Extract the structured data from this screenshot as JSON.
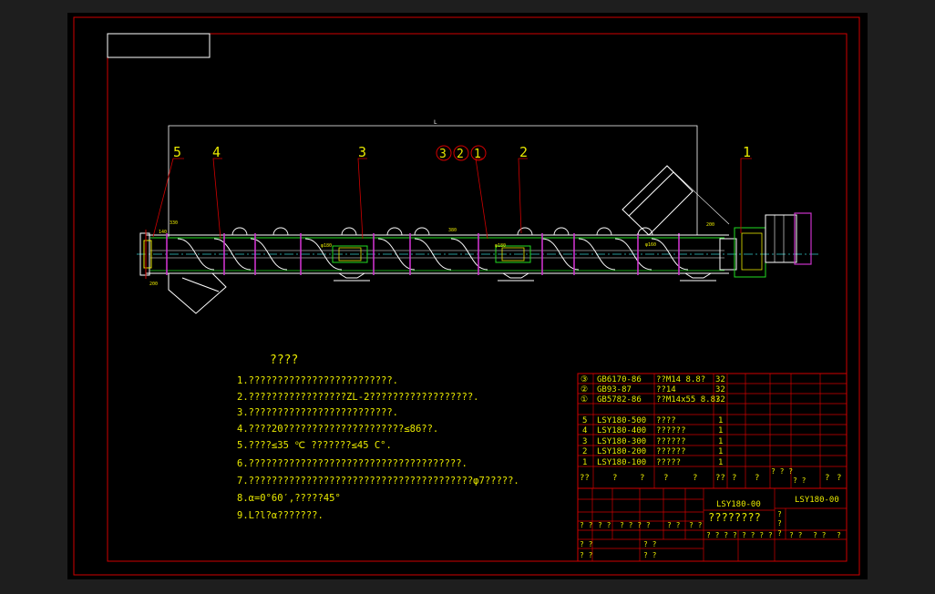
{
  "colors": {
    "background": "#1e1e1e",
    "paper": "#000000",
    "frame": "#d00000",
    "green": "#22dd22",
    "yellow": "#e8e800",
    "magenta": "#cc33cc",
    "cyan": "#33cccc",
    "white": "#ffffff",
    "blue": "#4466ff"
  },
  "drawing": {
    "dim_L": "L",
    "balloons": {
      "b5": "5",
      "b4": "4",
      "b3": "3",
      "b2": "2",
      "b1": "1",
      "c3": "3",
      "c2": "2",
      "c1": "1"
    },
    "dims": {
      "d140": "140",
      "d330": "330",
      "d200a": "200",
      "d200b": "200",
      "d380": "380",
      "d180": "φ180",
      "d1e5": "φ180",
      "d2160": "φ160"
    }
  },
  "notes": {
    "title": "????",
    "items": [
      "1.?????????????????????????.",
      "2.?????????????????ZL-2??????????????????.",
      "3.?????????????????????????.",
      "4.????20?????????????????????≤86??.",
      "5.????≤35 ℃ ???????≤45 C°.",
      "6.?????????????????????????????????????.",
      "7.???????????????????????????????????????φ7?????.",
      "8.α=0°60′,?????45°",
      "9.L?l?α???????."
    ]
  },
  "parts_list": {
    "rows": [
      {
        "no": "③",
        "code": "GB6170-86",
        "name": "??M14  8.8?",
        "qty": "32"
      },
      {
        "no": "②",
        "code": "GB93-87",
        "name": "??14",
        "qty": "32"
      },
      {
        "no": "①",
        "code": "GB5782-86",
        "name": "??M14x55  8.8?",
        "qty": "32"
      },
      {
        "no": "5",
        "code": "LSY180-500",
        "name": "????",
        "qty": "1"
      },
      {
        "no": "4",
        "code": "LSY180-400",
        "name": "??????",
        "qty": "1"
      },
      {
        "no": "3",
        "code": "LSY180-300",
        "name": "??????",
        "qty": "1"
      },
      {
        "no": "2",
        "code": "LSY180-200",
        "name": "??????",
        "qty": "1"
      },
      {
        "no": "1",
        "code": "LSY180-100",
        "name": "?????",
        "qty": "1"
      }
    ],
    "header": [
      "??",
      "?",
      "?",
      "?",
      "?",
      "??",
      "?",
      "?",
      "? ? ?",
      "? ?",
      "?",
      "?"
    ]
  },
  "title_block": {
    "drawing_no": "LSY180-00",
    "drawing_no_right": "LSY180-00",
    "drawing_name": "????????",
    "row_a": [
      "? ?",
      "? ?",
      "? ? ? ?",
      "? ?",
      "? ?"
    ],
    "row_b": [
      "? ? ? ?",
      "? ? ? ?",
      "? ?",
      "? ?",
      "?"
    ],
    "row_c": [
      "? ?",
      "? ?"
    ],
    "row_d": [
      "? ?",
      "? ?"
    ],
    "side": [
      "?",
      "?",
      "?"
    ]
  }
}
